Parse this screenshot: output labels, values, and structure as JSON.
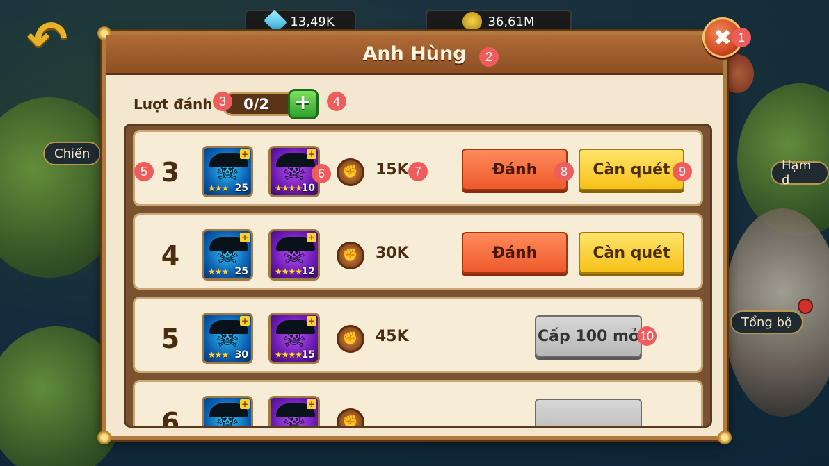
{
  "background": {
    "currency_gems": "13,49K",
    "currency_gold": "36,61M",
    "left_label": "Chiến",
    "right_label_1": "Hạm đ",
    "right_label_2": "Tổng bộ"
  },
  "dialog": {
    "title": "Anh Hùng",
    "close_icon": "✖",
    "turns": {
      "label": "Lượt đánh",
      "value": "0/2",
      "plus_icon": "+"
    }
  },
  "rows": [
    {
      "level": "3",
      "hero1": {
        "stars": "★★★",
        "level": "25"
      },
      "hero2": {
        "stars": "★★★★",
        "level": "10"
      },
      "power": "15K",
      "fight_label": "Đánh",
      "sweep_label": "Càn quét"
    },
    {
      "level": "4",
      "hero1": {
        "stars": "★★★",
        "level": "25"
      },
      "hero2": {
        "stars": "★★★★",
        "level": "12"
      },
      "power": "30K",
      "fight_label": "Đánh",
      "sweep_label": "Càn quét"
    },
    {
      "level": "5",
      "hero1": {
        "stars": "★★★",
        "level": "30"
      },
      "hero2": {
        "stars": "★★★★",
        "level": "15"
      },
      "power": "45K",
      "locked_label": "Cấp 100 mở"
    },
    {
      "level": "6",
      "hero1": {
        "stars": "★★★",
        "level": ""
      },
      "hero2": {
        "stars": "★★★★",
        "level": ""
      },
      "power": "",
      "locked_label": ""
    }
  ],
  "annotations": [
    "1",
    "2",
    "3",
    "4",
    "5",
    "6",
    "7",
    "8",
    "9",
    "10"
  ],
  "icons": {
    "skull": "☠",
    "fist": "✊",
    "back": "↶"
  }
}
